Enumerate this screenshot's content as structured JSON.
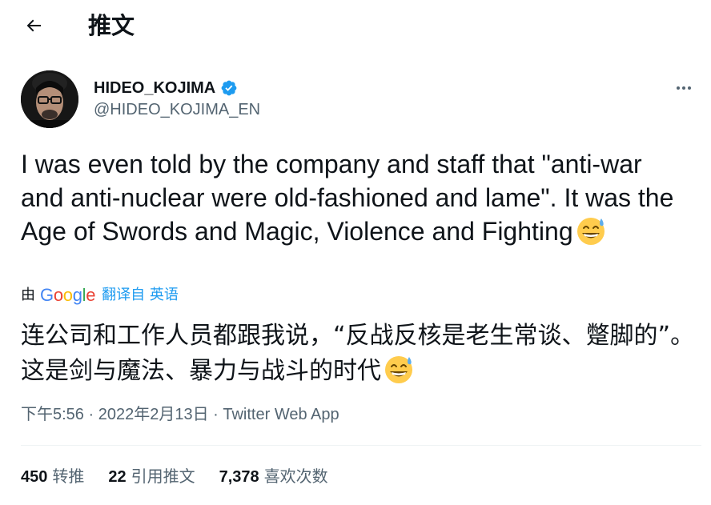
{
  "header": {
    "back_icon": "arrow-left-icon",
    "title": "推文"
  },
  "author": {
    "display_name": "HIDEO_KOJIMA",
    "verified_icon": "verified-badge-icon",
    "handle": "@HIDEO_KOJIMA_EN",
    "more_icon": "more-horizontal-icon"
  },
  "tweet": {
    "text": "I was even told by the company and staff that \"anti-war and anti-nuclear were old-fashioned and lame\". It was the Age of Swords and Magic, Violence and Fighting",
    "emoji_icon": "grinning-sweat-emoji-icon"
  },
  "translation": {
    "by_label": "由",
    "provider": "Google",
    "link_label": "翻译自 英语",
    "text": "连公司和工作人员都跟我说，“反战反核是老生常谈、蹩脚的”。这是剑与魔法、暴力与战斗的时代"
  },
  "meta": {
    "time": "下午5:56",
    "sep1": " · ",
    "date": "2022年2月13日",
    "sep2": " · ",
    "source": "Twitter Web App"
  },
  "stats": [
    {
      "count": "450",
      "label": "转推"
    },
    {
      "count": "22",
      "label": "引用推文"
    },
    {
      "count": "7,378",
      "label": "喜欢次数"
    }
  ],
  "colors": {
    "text": "#0f1419",
    "secondary": "#536471",
    "accent": "#1d9bf0",
    "divider": "#eff3f4"
  }
}
